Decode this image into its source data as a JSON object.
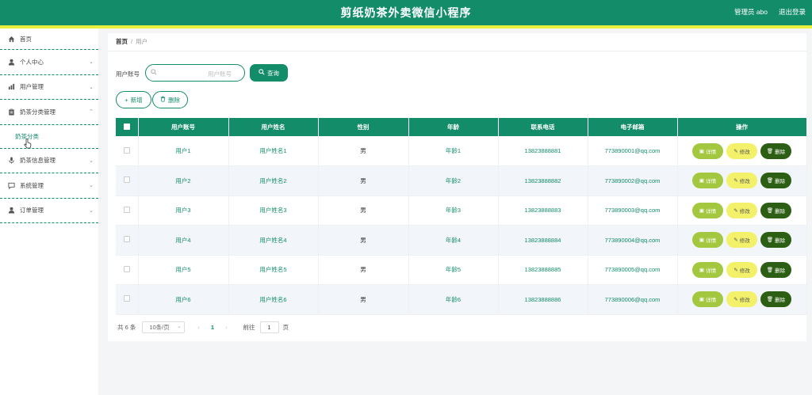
{
  "header": {
    "title": "剪纸奶茶外卖微信小程序",
    "user": "管理员 abo",
    "logout": "退出登录"
  },
  "sidebar": {
    "items": [
      {
        "label": "首页",
        "icon": "home-icon"
      },
      {
        "label": "个人中心",
        "icon": "user-icon"
      },
      {
        "label": "用户管理",
        "icon": "users-chart-icon"
      },
      {
        "label": "奶茶分类管理",
        "icon": "clipboard-icon",
        "expanded": true
      },
      {
        "label": "奶茶信息管理",
        "icon": "microphone-icon"
      },
      {
        "label": "系统管理",
        "icon": "chat-icon"
      },
      {
        "label": "订单管理",
        "icon": "user-icon"
      }
    ],
    "subitem": "奶茶分类"
  },
  "breadcrumb": {
    "home": "首页",
    "sep": "/",
    "current": "用户"
  },
  "search": {
    "label": "用户账号",
    "placeholder": "用户账号",
    "query_button": "查询"
  },
  "toolbar": {
    "add": "新增",
    "delete": "删除"
  },
  "table": {
    "columns": [
      "用户账号",
      "用户姓名",
      "性别",
      "年龄",
      "联系电话",
      "电子邮箱",
      "操作"
    ],
    "rows": [
      {
        "account": "用户1",
        "name": "用户姓名1",
        "gender": "男",
        "age": "年龄1",
        "phone": "13823888881",
        "email": "773890001@qq.com"
      },
      {
        "account": "用户2",
        "name": "用户姓名2",
        "gender": "男",
        "age": "年龄2",
        "phone": "13823888882",
        "email": "773890002@qq.com"
      },
      {
        "account": "用户3",
        "name": "用户姓名3",
        "gender": "男",
        "age": "年龄3",
        "phone": "13823888883",
        "email": "773890003@qq.com"
      },
      {
        "account": "用户4",
        "name": "用户姓名4",
        "gender": "男",
        "age": "年龄4",
        "phone": "13823888884",
        "email": "773890004@qq.com"
      },
      {
        "account": "用户5",
        "name": "用户姓名5",
        "gender": "男",
        "age": "年龄5",
        "phone": "13823888885",
        "email": "773890005@qq.com"
      },
      {
        "account": "用户6",
        "name": "用户姓名6",
        "gender": "男",
        "age": "年龄6",
        "phone": "13823888886",
        "email": "773890006@qq.com"
      }
    ],
    "actions": {
      "detail": "详情",
      "edit": "修改",
      "delete": "删除"
    }
  },
  "pagination": {
    "total": "共 6 条",
    "page_size": "10条/页",
    "current_page": "1",
    "goto_label": "前往",
    "goto_value": "1",
    "page_unit": "页"
  },
  "colors": {
    "primary": "#128c69",
    "accent": "#e8ef3c",
    "detail": "#a3c83f",
    "edit": "#f3f06a",
    "delete": "#2c5e13"
  }
}
